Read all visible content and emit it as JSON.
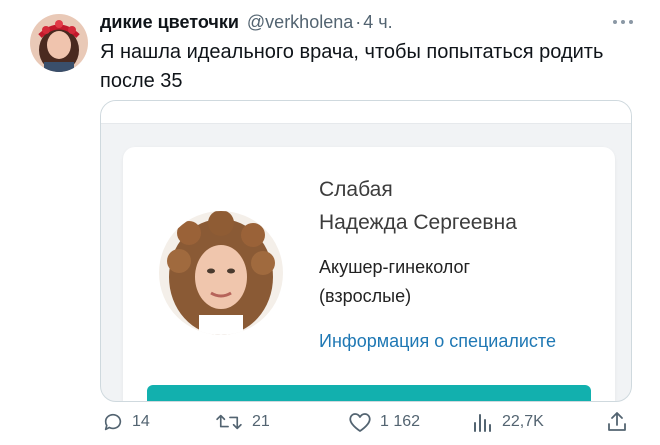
{
  "tweet": {
    "display_name": "дикие цветочки",
    "handle": "@verkholena",
    "separator": "·",
    "time": "4 ч.",
    "text": "Я нашла идеального врача, чтобы попытаться родить после 35"
  },
  "doctor_card": {
    "surname": "Слабая",
    "given_names": "Надежда Сергеевна",
    "specialty": "Акушер-гинеколог",
    "specialty_note": "(взрослые)",
    "info_link": "Информация о специалисте",
    "button_color": "#12b0ae",
    "link_color": "#1f78b4"
  },
  "actions": {
    "replies": "14",
    "retweets": "21",
    "likes": "1 162",
    "views": "22,7K"
  },
  "icons": [
    "more-icon",
    "reply-icon",
    "retweet-icon",
    "like-icon",
    "views-icon",
    "share-icon"
  ]
}
